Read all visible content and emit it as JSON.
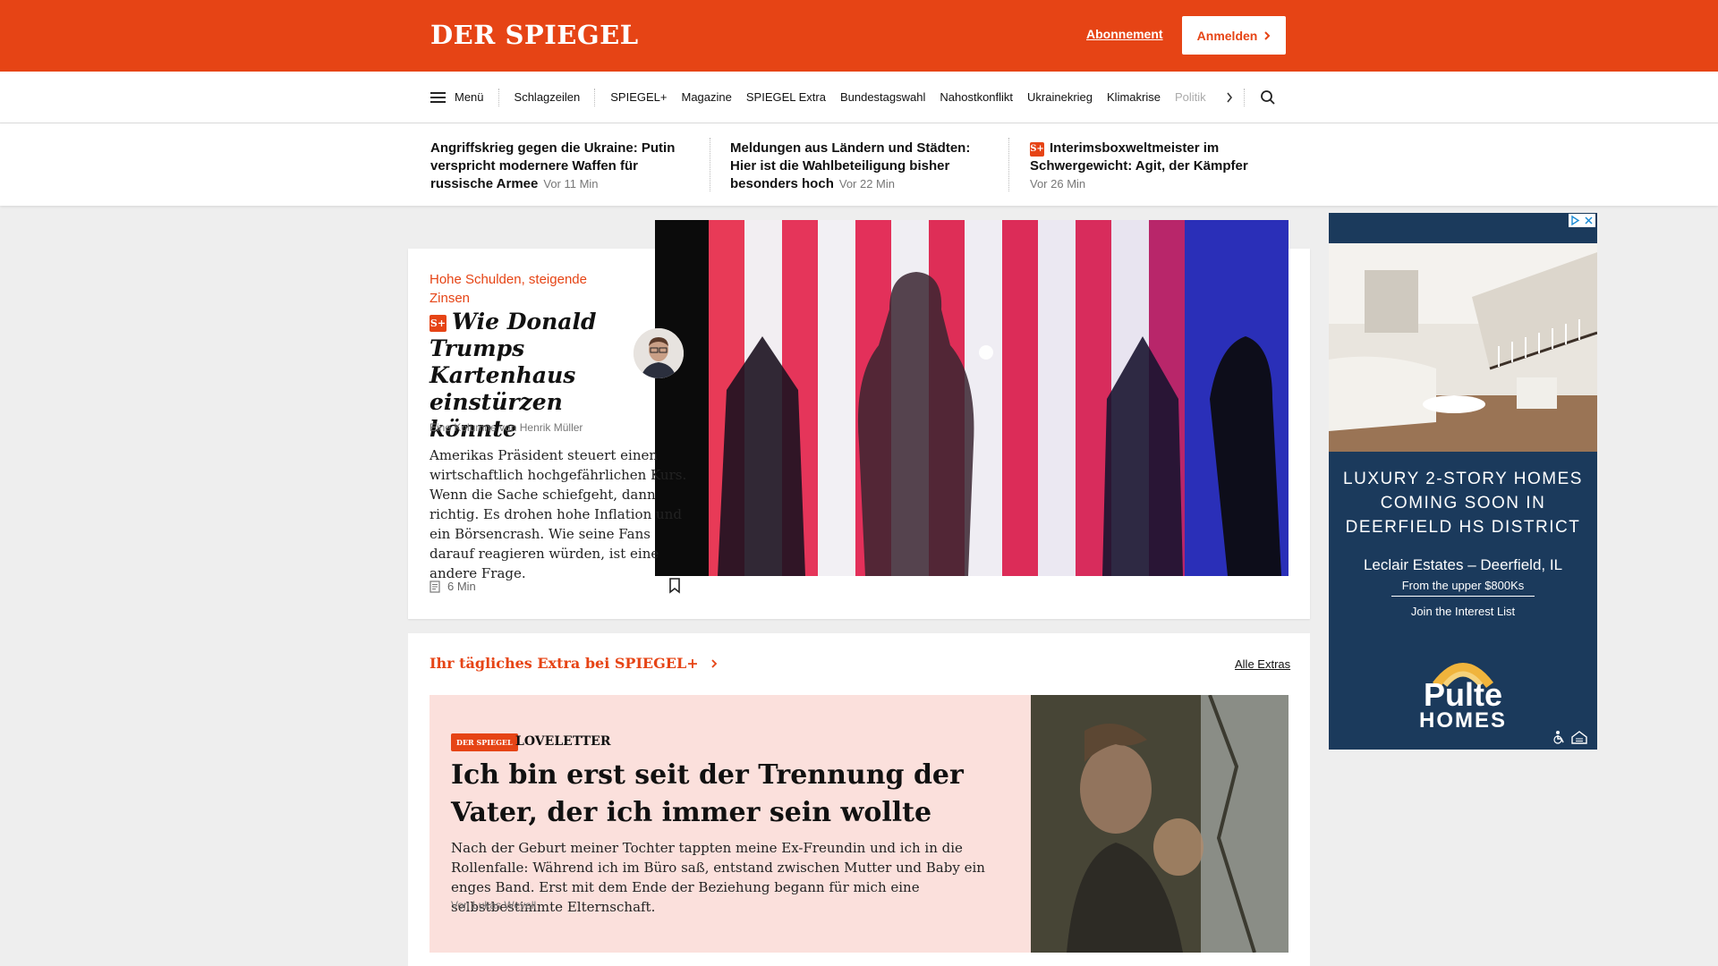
{
  "header": {
    "logo": "DER SPIEGEL",
    "abo_label": "Abonnement",
    "login_label": "Anmelden"
  },
  "nav": {
    "menu_label": "Menü",
    "items": [
      "Schlagzeilen",
      "SPIEGEL+",
      "Magazine",
      "SPIEGEL Extra",
      "Bundestagswahl",
      "Nahostkonflikt",
      "Ukrainekrieg",
      "Klimakrise"
    ],
    "fade_item": "Politik"
  },
  "ticker": [
    {
      "title": "Angriffskrieg gegen die Ukraine: Putin verspricht modernere Waffen für russische Armee",
      "time": "Vor 11 Min",
      "plus": false
    },
    {
      "title": "Meldungen aus Ländern und Städten: Hier ist die Wahlbeteiligung bisher besonders hoch",
      "time": "Vor 22 Min",
      "plus": false
    },
    {
      "title": "Interimsboxweltmeister im Schwergewicht: Agit, der Kämpfer",
      "time": "Vor 26 Min",
      "plus": true
    }
  ],
  "main_article": {
    "kicker": "Hohe Schulden, steigende Zinsen",
    "plus_badge": "S+",
    "headline": "Wie Donald Trumps Kartenhaus einstürzen könnte",
    "byline": "Eine Kolumne von Henrik Müller",
    "teaser": "Amerikas Präsident steuert einen wirtschaftlich hochgefährlichen Kurs. Wenn die Sache schiefgeht, dann richtig. Es drohen hohe Inflation und ein Börsencrash. Wie seine Fans darauf reagieren würden, ist eine andere Frage.",
    "read_time": "6 Min"
  },
  "extras": {
    "title": "Ihr tägliches Extra bei SPIEGEL+",
    "all_link": "Alle Extras",
    "badge": "DER SPIEGEL",
    "label": "LOVELETTER",
    "headline": "Ich bin erst seit der Trennung der Vater, der ich immer sein wollte",
    "teaser": "Nach der Geburt meiner Tochter tappten meine Ex-Freundin und ich in die Rollenfalle: Während ich im Büro saß, entstand zwischen Mutter und Baby ein enges Band. Erst mit dem Ende der Beziehung begann für mich eine selbstbestimmte Elternschaft.",
    "byline": "Von Lukas Weyell"
  },
  "ad": {
    "headline": "LUXURY 2-STORY HOMES COMING SOON IN DEERFIELD HS DISTRICT",
    "subtitle": "Leclair Estates – Deerfield, IL",
    "price": "From the upper $800Ks",
    "cta": "Join the Interest List",
    "brand_top": "Pulte",
    "brand_bottom": "HOMES"
  },
  "colors": {
    "brand": "#e64415",
    "ad_bg": "#1b3a5c",
    "pink": "#fbe0dc"
  }
}
